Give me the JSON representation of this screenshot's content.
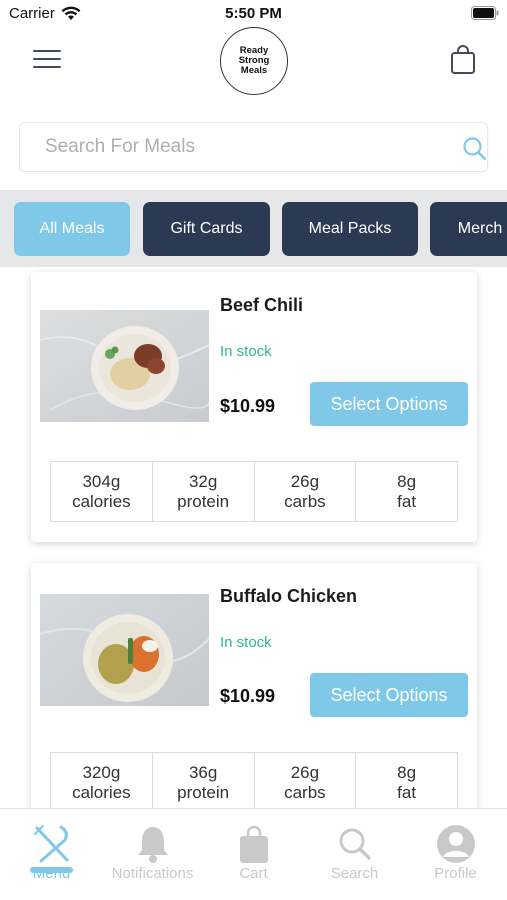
{
  "status_bar": {
    "carrier": "Carrier",
    "time": "5:50 PM"
  },
  "header": {
    "logo_text": "Ready Strong Meals"
  },
  "search": {
    "placeholder": "Search For Meals"
  },
  "categories": [
    {
      "label": "All Meals",
      "active": true
    },
    {
      "label": "Gift Cards",
      "active": false
    },
    {
      "label": "Meal Packs",
      "active": false
    },
    {
      "label": "Merch",
      "active": false
    }
  ],
  "products": [
    {
      "name": "Beef Chili",
      "stock": "In stock",
      "price": "$10.99",
      "button_label": "Select Options",
      "macros": [
        {
          "value": "304g",
          "label": "calories"
        },
        {
          "value": "32g",
          "label": "protein"
        },
        {
          "value": "26g",
          "label": "carbs"
        },
        {
          "value": "8g",
          "label": "fat"
        }
      ]
    },
    {
      "name": "Buffalo Chicken",
      "stock": "In stock",
      "price": "$10.99",
      "button_label": "Select Options",
      "macros": [
        {
          "value": "320g",
          "label": "calories"
        },
        {
          "value": "36g",
          "label": "protein"
        },
        {
          "value": "26g",
          "label": "carbs"
        },
        {
          "value": "8g",
          "label": "fat"
        }
      ]
    }
  ],
  "tabbar": {
    "items": [
      {
        "label": "Menu",
        "icon": "utensils-icon",
        "active": true
      },
      {
        "label": "Notifications",
        "icon": "bell-icon",
        "active": false
      },
      {
        "label": "Cart",
        "icon": "shopping-bag-icon",
        "active": false
      },
      {
        "label": "Search",
        "icon": "search-icon",
        "active": false
      },
      {
        "label": "Profile",
        "icon": "user-icon",
        "active": false
      }
    ]
  },
  "colors": {
    "accent": "#7fc8e8",
    "dark_chip": "#2b3a52",
    "in_stock": "#2fb98e",
    "category_bar": "#e6e7e9",
    "tab_inactive": "#c9c9c9"
  }
}
